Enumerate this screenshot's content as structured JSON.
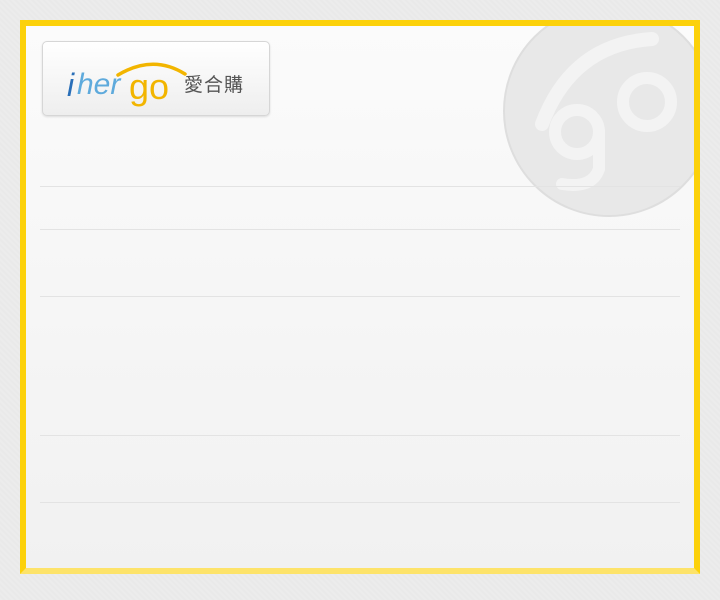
{
  "logo": {
    "latin_i": "i",
    "latin_her": "her",
    "latin_go": "go",
    "chinese": "愛合購",
    "colors": {
      "i": "#2a6fb8",
      "her": "#5eaadc",
      "go": "#f2b500",
      "arc": "#f2b500"
    }
  },
  "watermark": {
    "icon": "go-watermark-icon"
  },
  "colors": {
    "panel_border": "#fcd10a",
    "divider": "#e3e3e3"
  },
  "form": {
    "rows": 5
  }
}
